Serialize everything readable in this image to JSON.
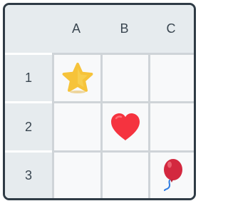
{
  "columns": [
    "A",
    "B",
    "C"
  ],
  "rows": [
    "1",
    "2",
    "3"
  ],
  "cells": {
    "A1": {
      "icon": "star-icon"
    },
    "B1": {
      "icon": ""
    },
    "C1": {
      "icon": ""
    },
    "A2": {
      "icon": ""
    },
    "B2": {
      "icon": "heart-icon"
    },
    "C2": {
      "icon": ""
    },
    "A3": {
      "icon": ""
    },
    "B3": {
      "icon": ""
    },
    "C3": {
      "icon": "balloon-icon"
    }
  },
  "colors": {
    "frame": "#2f3b45",
    "header_bg": "#e6ebee",
    "cell_bg": "#f8f9fa",
    "grid_line": "#cfd4d8",
    "star": "#f6c33a",
    "heart": "#f5333f",
    "balloon": "#d3283f",
    "balloon_string": "#2f7be0"
  }
}
